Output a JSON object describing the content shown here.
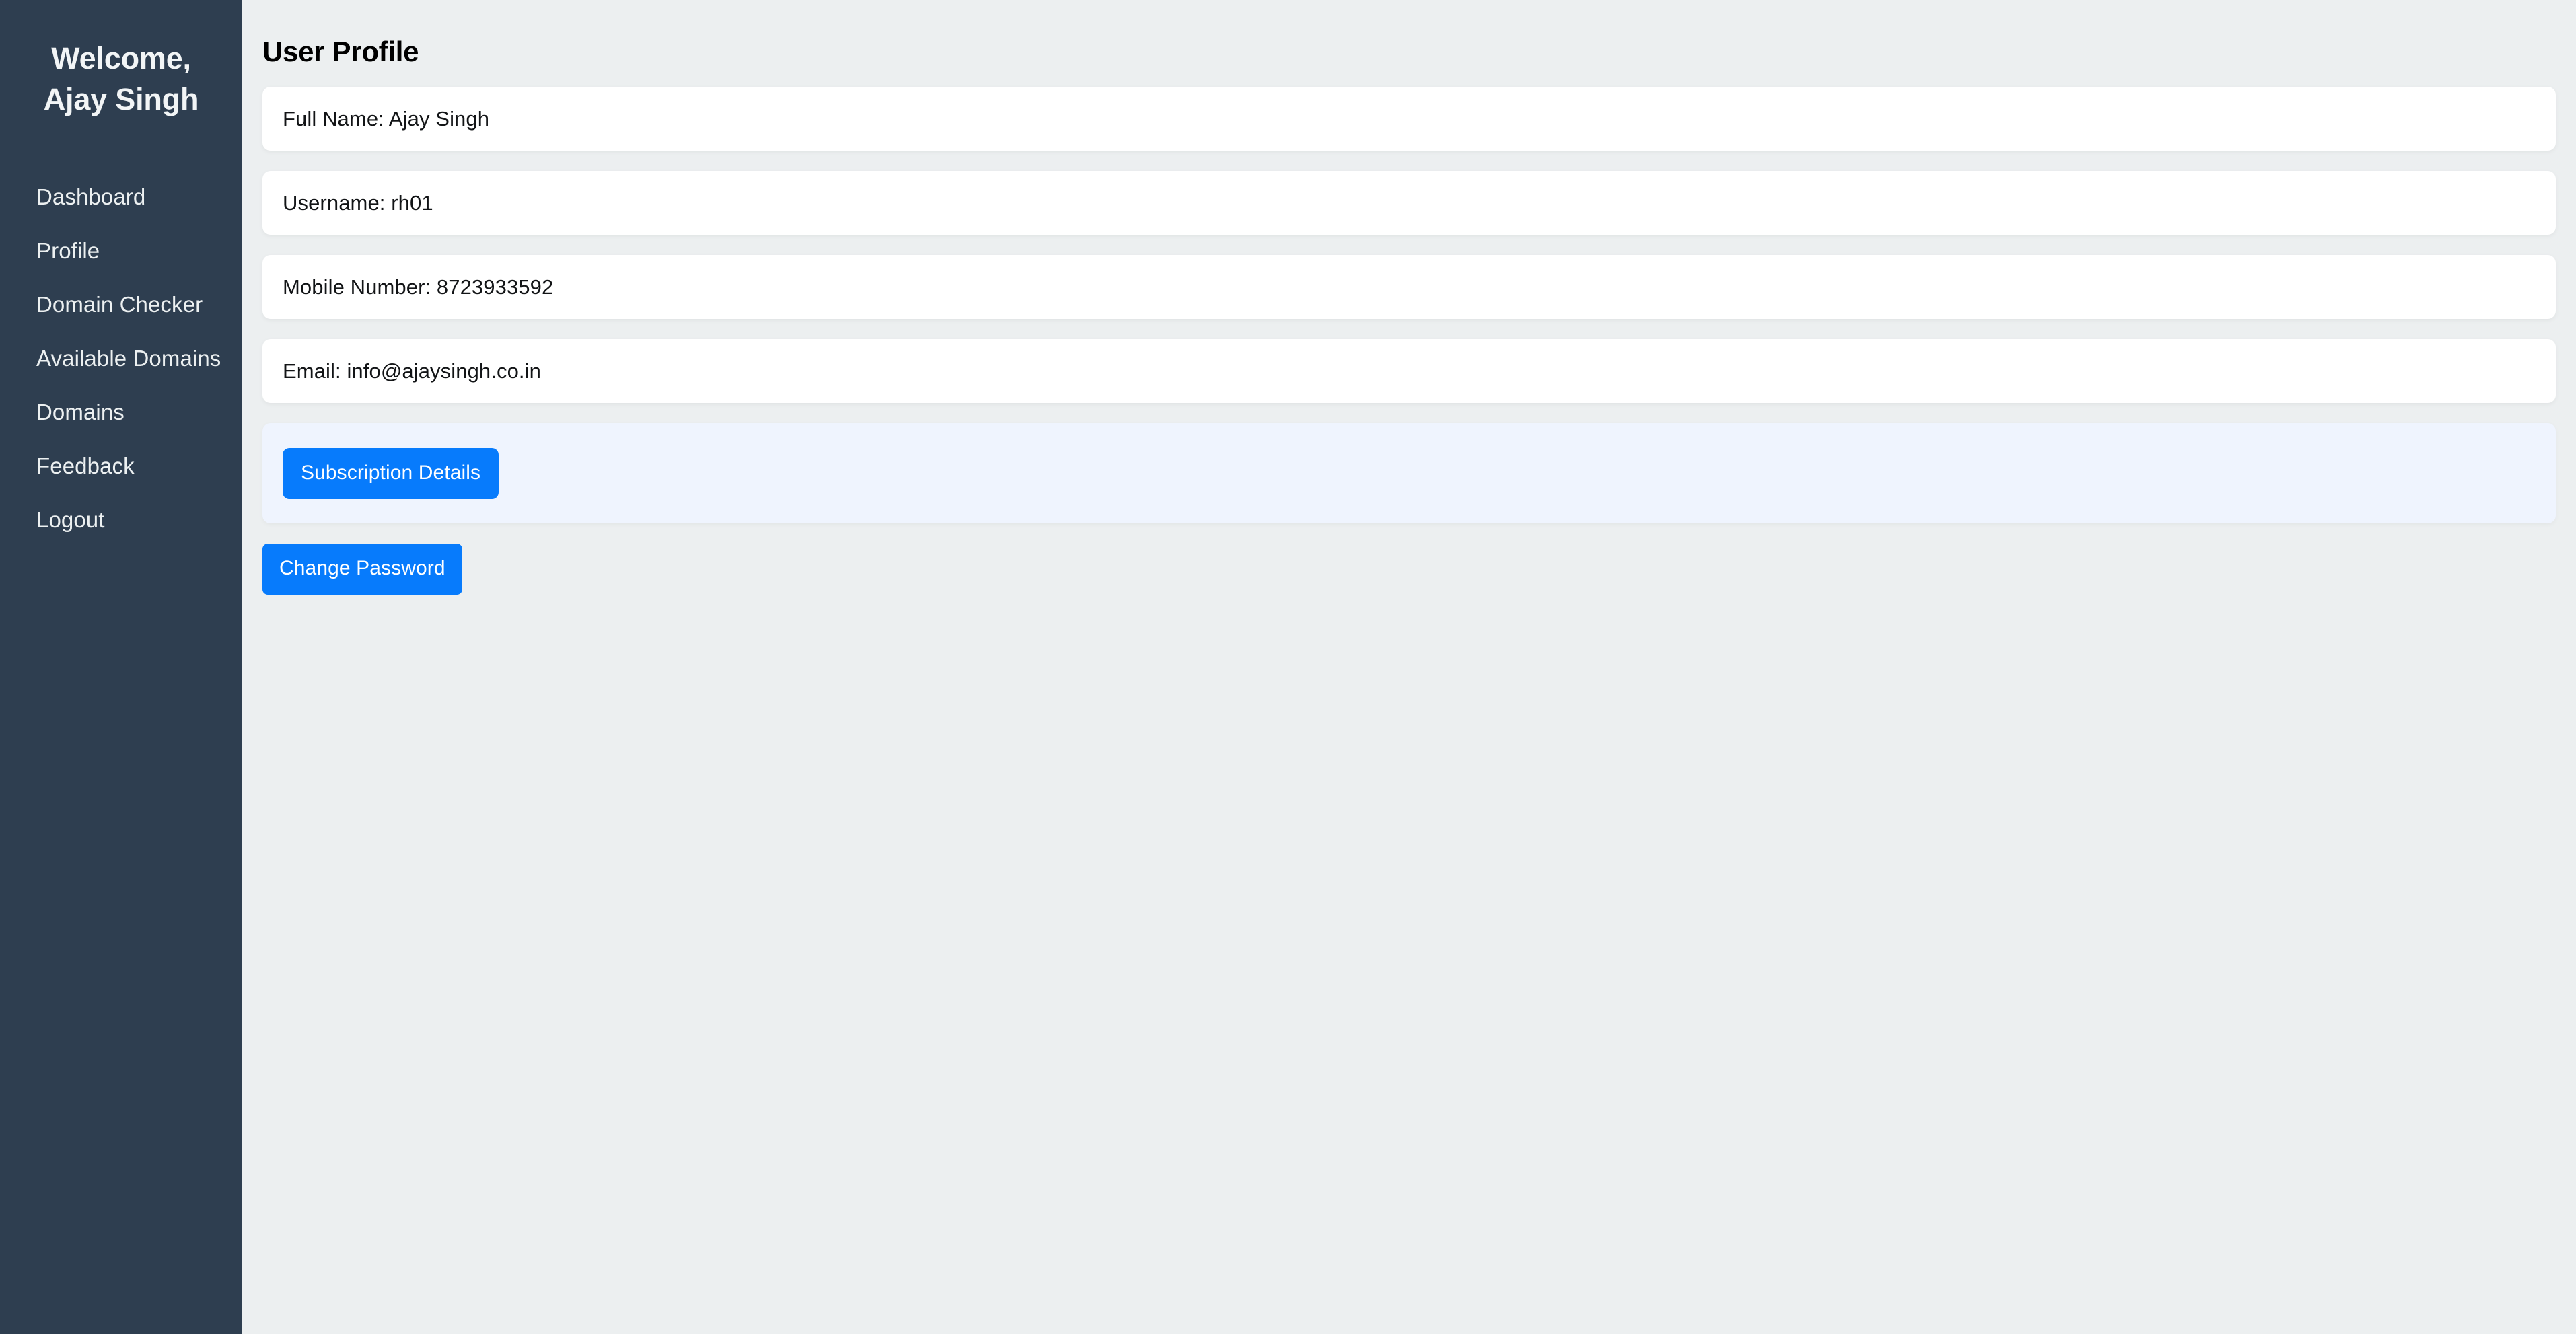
{
  "sidebar": {
    "welcome_line1": "Welcome,",
    "welcome_line2": "Ajay Singh",
    "items": [
      {
        "label": "Dashboard"
      },
      {
        "label": "Profile"
      },
      {
        "label": "Domain Checker"
      },
      {
        "label": "Available Domains"
      },
      {
        "label": "Domains"
      },
      {
        "label": "Feedback"
      },
      {
        "label": "Logout"
      }
    ]
  },
  "main": {
    "page_title": "User Profile",
    "fields": [
      {
        "text": "Full Name: Ajay Singh"
      },
      {
        "text": "Username: rh01"
      },
      {
        "text": "Mobile Number: 8723933592"
      },
      {
        "text": "Email: info@ajaysingh.co.in"
      }
    ],
    "subscription_button_label": "Subscription Details",
    "change_password_button_label": "Change Password"
  },
  "colors": {
    "sidebar_bg": "#2e3e50",
    "main_bg": "#eceff0",
    "card_bg": "#ffffff",
    "subscription_card_bg": "#eff4fe",
    "accent_blue": "#077bfc",
    "sidebar_text": "#ecf0f1"
  }
}
